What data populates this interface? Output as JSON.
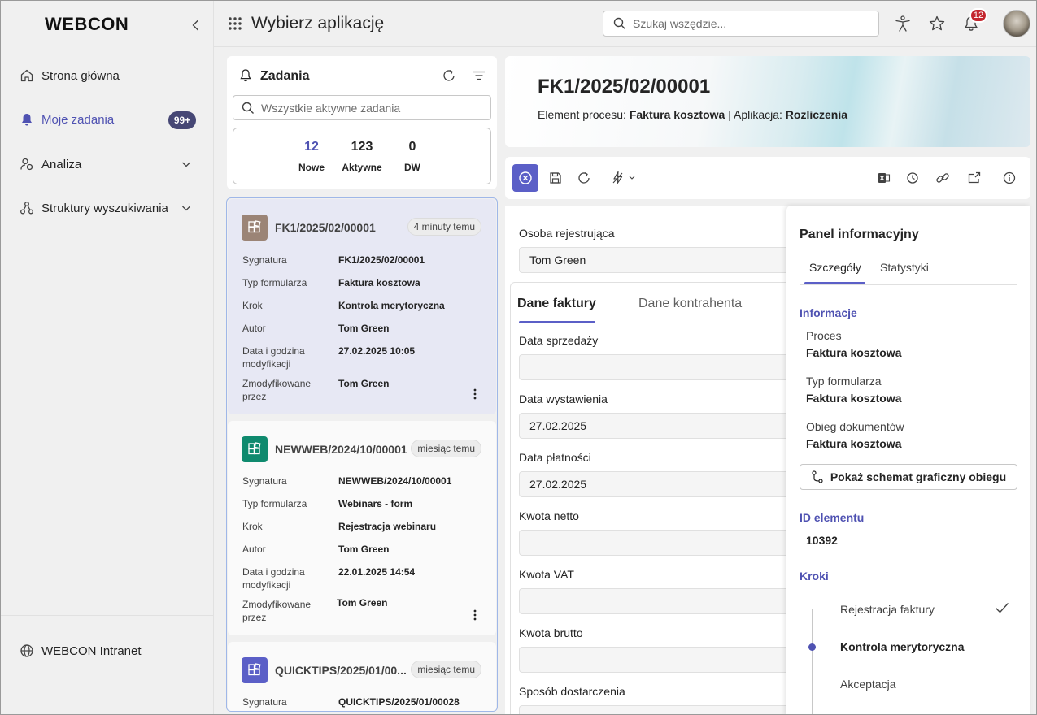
{
  "sidebar": {
    "logo": "WEBCON",
    "items": [
      {
        "label": "Strona główna"
      },
      {
        "label": "Moje zadania",
        "badge": "99+"
      },
      {
        "label": "Analiza"
      },
      {
        "label": "Struktury wyszukiwania"
      }
    ],
    "footer": {
      "label": "WEBCON Intranet"
    }
  },
  "topbar": {
    "title": "Wybierz aplikację",
    "search_placeholder": "Szukaj wszędzie...",
    "notification_count": "12"
  },
  "tasks": {
    "title": "Zadania",
    "search_placeholder": "Wszystkie aktywne zadania",
    "counts": [
      {
        "value": "12",
        "label": "Nowe"
      },
      {
        "value": "123",
        "label": "Aktywne"
      },
      {
        "value": "0",
        "label": "DW"
      }
    ],
    "field_labels": {
      "signature": "Sygnatura",
      "form_type": "Typ formularza",
      "step": "Krok",
      "author": "Autor",
      "modified_date": "Data i godzina modyfikacji",
      "modified_by": "Zmodyfikowane przez"
    },
    "cards": [
      {
        "title": "FK1/2025/02/00001",
        "time": "4 minuty temu",
        "signature": "FK1/2025/02/00001",
        "form_type": "Faktura kosztowa",
        "step": "Kontrola merytoryczna",
        "author": "Tom Green",
        "modified_date": "27.02.2025 10:05",
        "modified_by": "Tom Green",
        "color": "#9b8476"
      },
      {
        "title": "NEWWEB/2024/10/00001",
        "time": "miesiąc temu",
        "signature": "NEWWEB/2024/10/00001",
        "form_type": "Webinars - form",
        "step": "Rejestracja webinaru",
        "author": "Tom Green",
        "modified_date": "22.01.2025 14:54",
        "modified_by": "Tom Green",
        "color": "#0f8a6e"
      },
      {
        "title": "QUICKTIPS/2025/01/00...",
        "time": "miesiąc temu",
        "signature": "QUICKTIPS/2025/01/00028",
        "color": "#5b5fc7"
      }
    ]
  },
  "header": {
    "title": "FK1/2025/02/00001",
    "sub_label1": "Element procesu:",
    "sub_value1": "Faktura kosztowa",
    "sub_sep": "|",
    "sub_label2": "Aplikacja:",
    "sub_value2": "Rozliczenia"
  },
  "form": {
    "registrant_label": "Osoba rejestrująca",
    "registrant_value": "Tom Green",
    "tabs": [
      "Dane faktury",
      "Dane kontrahenta"
    ],
    "fields": [
      {
        "label": "Data sprzedaży",
        "value": ""
      },
      {
        "label": "Data wystawienia",
        "value": "27.02.2025"
      },
      {
        "label": "Data płatności",
        "value": "27.02.2025"
      },
      {
        "label": "Kwota netto",
        "value": ""
      },
      {
        "label": "Kwota VAT",
        "value": ""
      },
      {
        "label": "Kwota brutto",
        "value": ""
      },
      {
        "label": "Sposób dostarczenia",
        "value": ""
      }
    ]
  },
  "panel": {
    "title": "Panel informacyjny",
    "tabs": [
      "Szczegóły",
      "Statystyki"
    ],
    "info_section": "Informacje",
    "process_label": "Proces",
    "process_value": "Faktura kosztowa",
    "form_type_label": "Typ formularza",
    "form_type_value": "Faktura kosztowa",
    "workflow_label": "Obieg dokumentów",
    "workflow_value": "Faktura kosztowa",
    "diagram_button": "Pokaż schemat graficzny obiegu",
    "id_section": "ID elementu",
    "id_value": "10392",
    "steps_section": "Kroki",
    "steps": [
      "Rejestracja faktury",
      "Kontrola merytoryczna",
      "Akceptacja"
    ]
  },
  "colors": {
    "accent": "#5b5fc7",
    "accent_text": "#4f52b2",
    "badge": "#464775",
    "notification": "#c4262e"
  }
}
